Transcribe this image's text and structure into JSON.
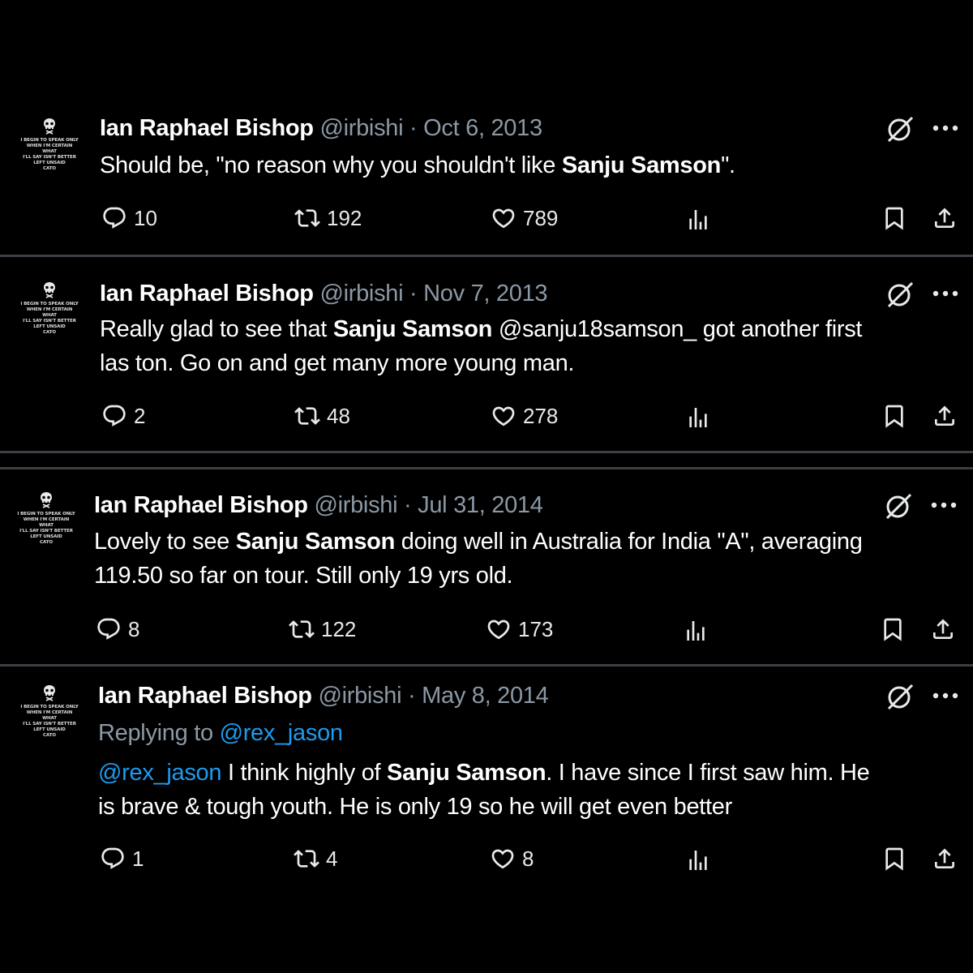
{
  "tweets": [
    {
      "author": "Ian Raphael Bishop",
      "handle": "@irbishi",
      "sep": "·",
      "date": "Oct 6, 2013",
      "text_parts": [
        "Should be, \"no reason why you shouldn't like ",
        "Sanju Samson",
        "\"."
      ],
      "replies": "10",
      "reposts": "192",
      "likes": "789"
    },
    {
      "author": "Ian Raphael Bishop",
      "handle": "@irbishi",
      "sep": "·",
      "date": "Nov 7, 2013",
      "text_parts": [
        "Really glad to see that ",
        "Sanju Samson",
        " @sanju18samson_ got another first",
        "las ton. Go on and get many more young man."
      ],
      "replies": "2",
      "reposts": "48",
      "likes": "278"
    },
    {
      "author": "Ian Raphael Bishop",
      "handle": "@irbishi",
      "sep": "·",
      "date": "Jul 31, 2014",
      "text_parts": [
        "Lovely to see ",
        "Sanju Samson",
        " doing well in Australia for India \"A\", averaging",
        "119.50 so far on tour. Still only 19 yrs old."
      ],
      "replies": "8",
      "reposts": "122",
      "likes": "173"
    },
    {
      "author": "Ian Raphael Bishop",
      "handle": "@irbishi",
      "sep": "·",
      "date": "May 8, 2014",
      "replying_label": "Replying to",
      "replying_to": "@rex_jason",
      "text_parts": [
        "@rex_jason",
        " I think highly of ",
        "Sanju Samson",
        ". I have since I first saw him. He",
        "is brave & tough youth. He is only 19 so he will get even better"
      ],
      "replies": "1",
      "reposts": "4",
      "likes": "8"
    }
  ],
  "avatar_logo_text": [
    "I BEGIN TO SPEAK ONLY",
    "WHEN I'M CERTAIN WHAT",
    "I'LL SAY ISN'T BETTER",
    "LEFT UNSAID",
    "CATO"
  ],
  "icons": {
    "reply": "speech-bubble-icon",
    "repost": "repost-arrows-icon",
    "like": "heart-icon",
    "views": "bar-chart-icon",
    "bookmark": "bookmark-icon",
    "share": "share-upload-icon",
    "grok": "grok-slash-circle-icon",
    "more": "more-dots-icon"
  },
  "colors": {
    "background": "#000000",
    "text": "#ffffff",
    "secondary": "#8b98a5",
    "mention": "#1d9bf0",
    "divider": "#3b4046"
  }
}
